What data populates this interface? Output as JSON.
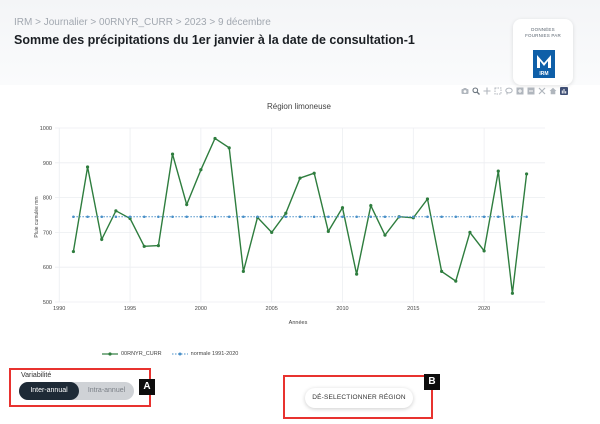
{
  "header": {
    "breadcrumb": "IRM > Journalier > 00RNYR_CURR > 2023 > 9 décembre",
    "title": "Somme des précipitations du 1er janvier à la date de consultation-1"
  },
  "logo": {
    "caption_line1": "DONNÉES",
    "caption_line2": "FOURNIES PAR",
    "brand": "IRM",
    "brand_color": "#0e5fa8"
  },
  "modebar": {
    "icons": [
      "camera-icon",
      "zoom-icon",
      "pan-icon",
      "box-select-icon",
      "lasso-icon",
      "zoom-in-icon",
      "zoom-out-icon",
      "autoscale-icon",
      "home-icon",
      "plotly-logo-icon"
    ]
  },
  "chart_data": {
    "type": "line",
    "title": "Région limoneuse",
    "xlabel": "Années",
    "ylabel": "Pluie cumulée mm",
    "xlim": [
      1989.7,
      2024.3
    ],
    "ylim": [
      500,
      1000
    ],
    "x_ticks": [
      1990,
      1995,
      2000,
      2005,
      2010,
      2015,
      2020
    ],
    "y_ticks": [
      500,
      600,
      700,
      800,
      900,
      1000
    ],
    "grid": true,
    "legend_position": "bottom-left",
    "x": [
      1991,
      1992,
      1993,
      1994,
      1995,
      1996,
      1997,
      1998,
      1999,
      2000,
      2001,
      2002,
      2003,
      2004,
      2005,
      2006,
      2007,
      2008,
      2009,
      2010,
      2011,
      2012,
      2013,
      2014,
      2015,
      2016,
      2017,
      2018,
      2019,
      2020,
      2021,
      2022,
      2023
    ],
    "series": [
      {
        "name": "00RNYR_CURR",
        "color": "#2e7d3e",
        "values": [
          645,
          888,
          680,
          762,
          740,
          660,
          662,
          925,
          780,
          880,
          970,
          943,
          588,
          743,
          700,
          755,
          856,
          870,
          703,
          771,
          580,
          777,
          692,
          745,
          742,
          796,
          588,
          560,
          700,
          647,
          876,
          525,
          868
        ]
      },
      {
        "name": "normale 1991-2020",
        "color": "#4a90c8",
        "values": [
          745,
          745,
          745,
          745,
          745,
          745,
          745,
          745,
          745,
          745,
          745,
          745,
          745,
          745,
          745,
          745,
          745,
          745,
          745,
          745,
          745,
          745,
          745,
          745,
          745,
          745,
          745,
          745,
          745,
          745,
          745,
          745,
          745
        ]
      }
    ]
  },
  "controls": {
    "variability_label": "Variabilité",
    "options": [
      "Inter-annual",
      "Intra-annuel"
    ],
    "selected": "Inter-annual",
    "deselect_label": "DÉ-SELECTIONNER RÉGION"
  },
  "annotations": {
    "a": "A",
    "b": "B",
    "color": "#e8322f"
  }
}
